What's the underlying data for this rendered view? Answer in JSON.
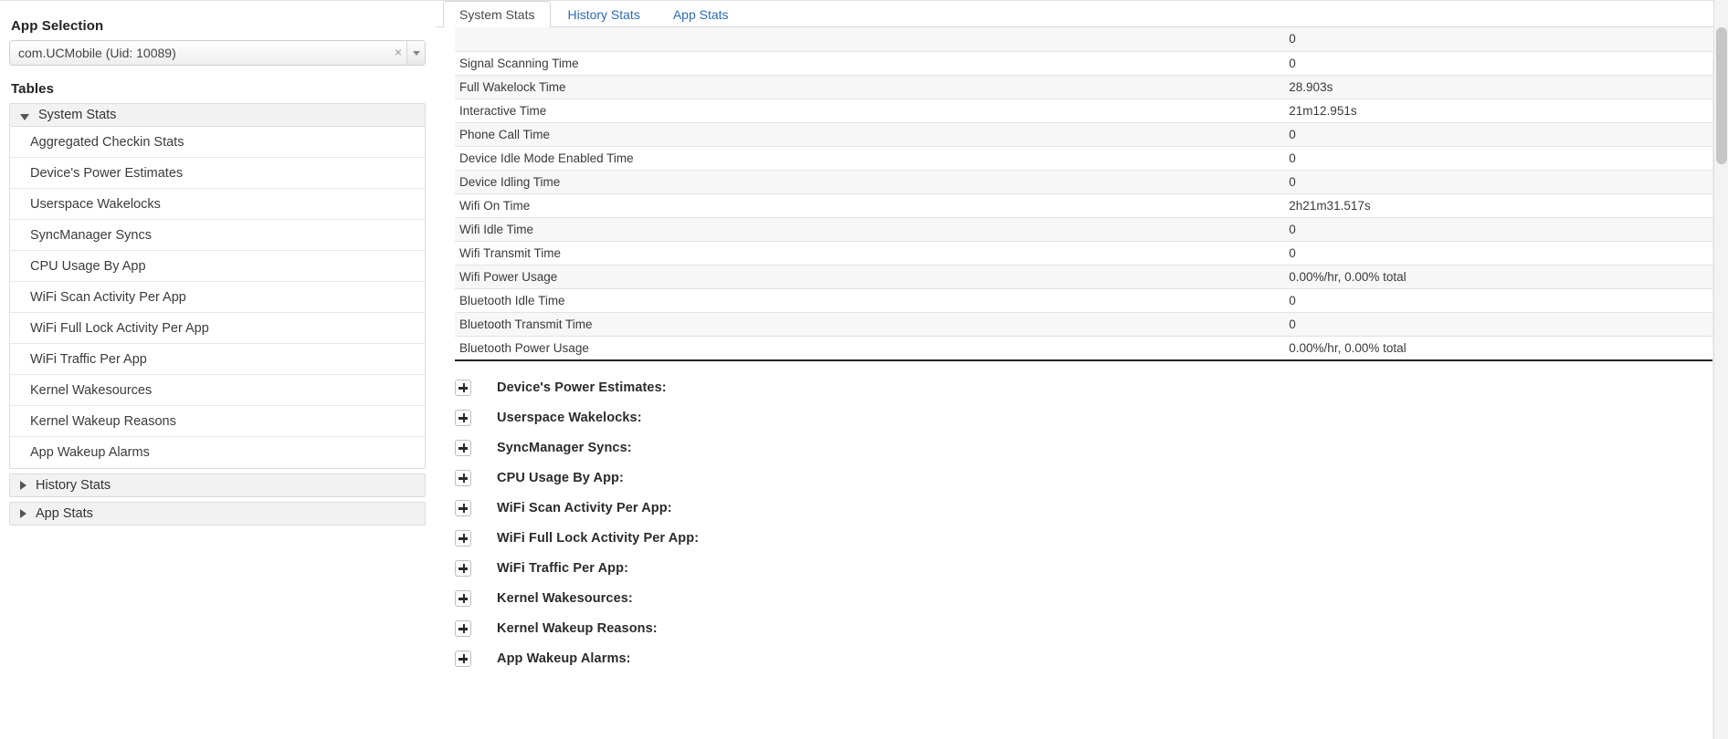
{
  "sidebar": {
    "app_selection_label": "App Selection",
    "app_select": {
      "value": "com.UCMobile (Uid: 10089)",
      "clear_icon": "×",
      "caret_icon": "chevron-down-icon"
    },
    "tables_label": "Tables",
    "groups": [
      {
        "label": "System Stats",
        "expanded": true,
        "items": [
          "Aggregated Checkin Stats",
          "Device's Power Estimates",
          "Userspace Wakelocks",
          "SyncManager Syncs",
          "CPU Usage By App",
          "WiFi Scan Activity Per App",
          "WiFi Full Lock Activity Per App",
          "WiFi Traffic Per App",
          "Kernel Wakesources",
          "Kernel Wakeup Reasons",
          "App Wakeup Alarms"
        ]
      },
      {
        "label": "History Stats",
        "expanded": false,
        "items": []
      },
      {
        "label": "App Stats",
        "expanded": false,
        "items": []
      }
    ]
  },
  "main": {
    "tabs": [
      {
        "label": "System Stats",
        "active": true
      },
      {
        "label": "History Stats",
        "active": false
      },
      {
        "label": "App Stats",
        "active": false
      }
    ],
    "table": {
      "clipped_top_value": "0",
      "rows": [
        {
          "name": "Signal Scanning Time",
          "value": "0"
        },
        {
          "name": "Full Wakelock Time",
          "value": "28.903s"
        },
        {
          "name": "Interactive Time",
          "value": "21m12.951s"
        },
        {
          "name": "Phone Call Time",
          "value": "0"
        },
        {
          "name": "Device Idle Mode Enabled Time",
          "value": "0"
        },
        {
          "name": "Device Idling Time",
          "value": "0"
        },
        {
          "name": "Wifi On Time",
          "value": "2h21m31.517s"
        },
        {
          "name": "Wifi Idle Time",
          "value": "0"
        },
        {
          "name": "Wifi Transmit Time",
          "value": "0"
        },
        {
          "name": "Wifi Power Usage",
          "value": "0.00%/hr, 0.00% total"
        },
        {
          "name": "Bluetooth Idle Time",
          "value": "0"
        },
        {
          "name": "Bluetooth Transmit Time",
          "value": "0"
        },
        {
          "name": "Bluetooth Power Usage",
          "value": "0.00%/hr, 0.00% total"
        }
      ]
    },
    "sections": [
      {
        "label": "Device's Power Estimates:",
        "toggle": "plus-icon"
      },
      {
        "label": "Userspace Wakelocks:",
        "toggle": "plus-icon"
      },
      {
        "label": "SyncManager Syncs:",
        "toggle": "plus-icon"
      },
      {
        "label": "CPU Usage By App:",
        "toggle": "plus-icon"
      },
      {
        "label": "WiFi Scan Activity Per App:",
        "toggle": "plus-icon"
      },
      {
        "label": "WiFi Full Lock Activity Per App:",
        "toggle": "plus-icon"
      },
      {
        "label": "WiFi Traffic Per App:",
        "toggle": "plus-icon"
      },
      {
        "label": "Kernel Wakesources:",
        "toggle": "plus-icon"
      },
      {
        "label": "Kernel Wakeup Reasons:",
        "toggle": "plus-icon"
      },
      {
        "label": "App Wakeup Alarms:",
        "toggle": "plus-icon"
      }
    ]
  },
  "colors": {
    "tab_link": "#2d6cb3",
    "row_alt": "#f7f7f7",
    "group_header_bg": "#f2f2f2",
    "border": "#dcdcdc"
  }
}
